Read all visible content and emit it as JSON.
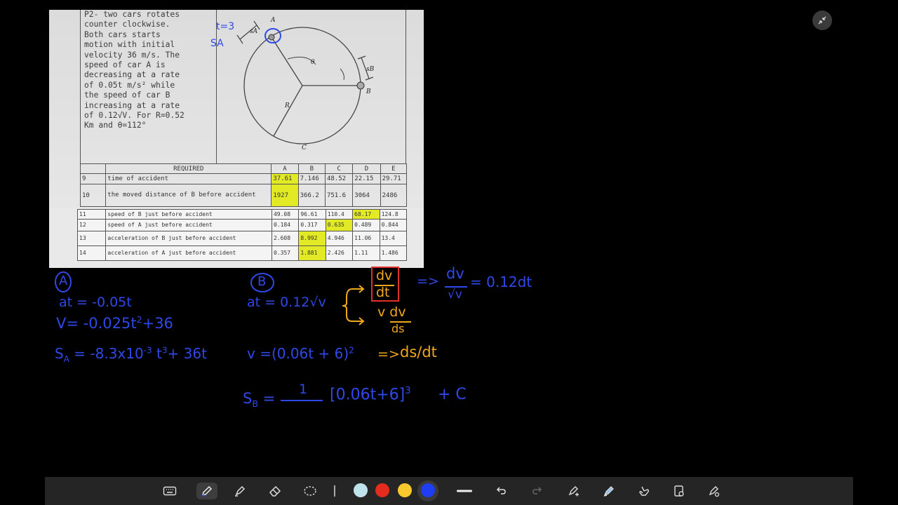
{
  "problem": {
    "text_lines": [
      "P2- two cars rotates",
      "counter clockwise.",
      "Both cars starts",
      "motion with initial",
      "velocity 36 m/s. The",
      "speed of car A is",
      "decreasing at a rate",
      "of 0.05t m/s² while",
      "the speed of car B",
      "increasing at a rate",
      "of 0.12√V. For R=0.52",
      "Km and θ=112°"
    ],
    "figure_labels": {
      "a": "A",
      "b": "B",
      "c": "C",
      "r": "R",
      "theta": "θ",
      "sa": "sA",
      "sb": "sB"
    }
  },
  "table_top": {
    "header": [
      "",
      "REQUIRED",
      "A",
      "B",
      "C",
      "D",
      "E"
    ],
    "rows": [
      {
        "num": "9",
        "label": "time of accident",
        "vals": [
          "37.61",
          "7.146",
          "48.52",
          "22.15",
          "29.71"
        ]
      },
      {
        "num": "10",
        "label": "the moved distance of B before accident",
        "vals": [
          "1927",
          "366.2",
          "751.6",
          "3064",
          "2486"
        ]
      }
    ]
  },
  "table_bottom": {
    "rows": [
      {
        "num": "11",
        "label": "speed of B just before accident",
        "vals": [
          "49.08",
          "96.61",
          "110.4",
          "68.17",
          "124.8"
        ]
      },
      {
        "num": "12",
        "label": "speed of A just before accident",
        "vals": [
          "0.184",
          "0.317",
          "0.635",
          "0.489",
          "0.844"
        ]
      },
      {
        "num": "13",
        "label": "acceleration of B just before accident",
        "vals": [
          "2.608",
          "8.992",
          "4.946",
          "11.06",
          "13.4"
        ]
      },
      {
        "num": "14",
        "label": "acceleration of A just before accident",
        "vals": [
          "0.357",
          "1.881",
          "2.426",
          "1.11",
          "1.486"
        ]
      }
    ]
  },
  "annotations": {
    "t_eq_3": "t=3",
    "s_a": "SA",
    "label_a": "A",
    "label_b": "B",
    "a_eq1_lhs": "at = -0.05t",
    "a_eq2_lhs": "V= -0.025t",
    "a_eq2_exp": "2",
    "a_eq2_rhs": "+36",
    "a_eq3_lhs": "S",
    "a_eq3_sub": "A",
    "a_eq3_mid": " = -8.3x10",
    "a_eq3_exp1": "-3",
    "a_eq3_t": " t",
    "a_eq3_exp2": "3",
    "a_eq3_rhs": "+ 36t",
    "b_eq1": "at = 0.12√v",
    "b_frac1_num": "dv",
    "b_frac1_den": "dt",
    "b_frac2_num": "v dv",
    "b_frac2_den": "ds",
    "b_arrow1": "=>",
    "b_frac3_num": "dv",
    "b_frac3_den": "√v",
    "b_eq1_rhs": "= 0.12dt",
    "b_eq2_lhs": "v =(0.06t  + 6)",
    "b_eq2_exp": "2",
    "b_eq2_arrow": "=>",
    "b_eq2_rhs": "ds/dt",
    "b_eq3_lhs": "S",
    "b_eq3_sub": "B",
    "b_eq3_eq": " =",
    "b_eq3_num": "1",
    "b_eq3_bracket": "[0.06t+6]",
    "b_eq3_exp": "3",
    "b_eq3_rhs": "+ C"
  },
  "toolbar": {
    "tools": [
      "keyboard-icon",
      "pen-icon",
      "highlighter-icon",
      "eraser-icon",
      "lasso-icon",
      "thickness-icon",
      "undo-icon",
      "redo-icon",
      "shape-icon",
      "ruler-icon",
      "touch-icon",
      "page-icon",
      "more-icon"
    ],
    "colors": [
      "#bfe3ea",
      "#e32b1e",
      "#f7c92c",
      "#1f3df2"
    ],
    "selected_color": "#1f3df2"
  },
  "colors": {
    "ink_blue": "#2f48e8",
    "ink_orange": "#f0a81a",
    "highlight": "#e2ea26",
    "ink_red": "#e0302a"
  }
}
